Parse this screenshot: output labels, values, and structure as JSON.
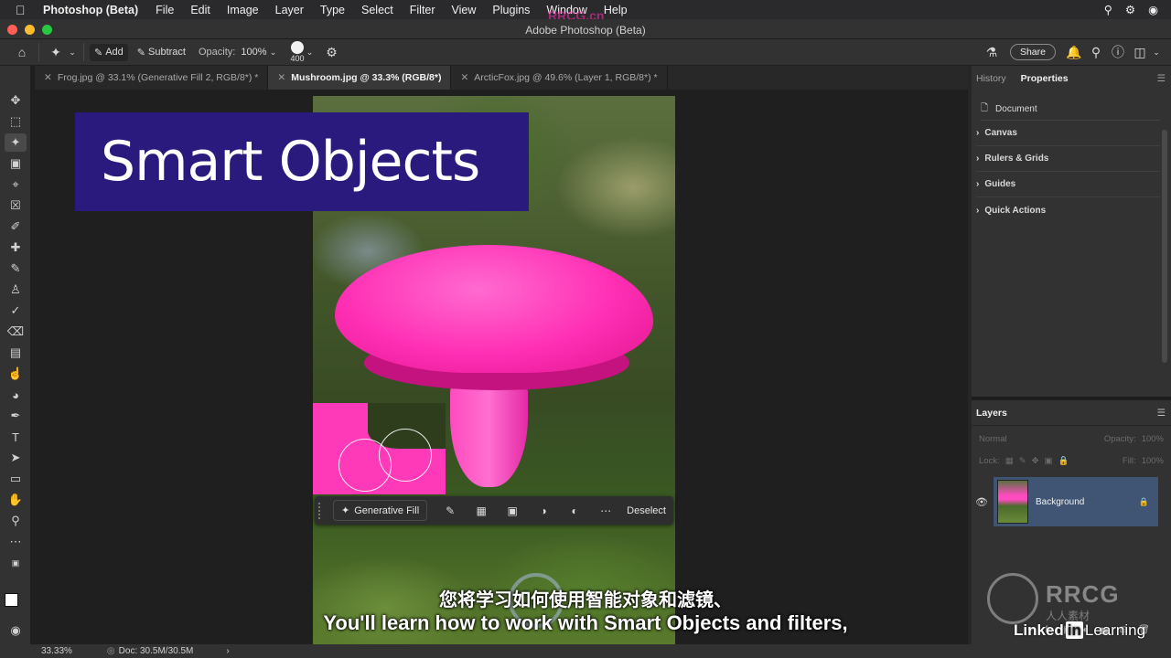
{
  "menubar": {
    "app_name": "Photoshop (Beta)",
    "items": [
      "File",
      "Edit",
      "Image",
      "Layer",
      "Type",
      "Select",
      "Filter",
      "View",
      "Plugins",
      "Window",
      "Help"
    ],
    "watermark": "RRCG.cn"
  },
  "window": {
    "title": "Adobe Photoshop (Beta)"
  },
  "options": {
    "add_label": "Add",
    "subtract_label": "Subtract",
    "opacity_label": "Opacity:",
    "opacity_value": "100%",
    "brush_size": "400",
    "share_label": "Share"
  },
  "tabs": [
    {
      "label": "Frog.jpg @ 33.1% (Generative Fill 2, RGB/8*) *",
      "active": false
    },
    {
      "label": "Mushroom.jpg @ 33.3% (RGB/8*)",
      "active": true
    },
    {
      "label": "ArcticFox.jpg @ 49.6% (Layer 1, RGB/8*) *",
      "active": false
    }
  ],
  "canvas": {
    "banner_text": "Smart Objects"
  },
  "context_bar": {
    "generative_fill": "Generative Fill",
    "deselect": "Deselect"
  },
  "subtitles": {
    "chinese": "您将学习如何使用智能对象和滤镜、",
    "english": "You'll learn how to work with Smart Objects and filters,"
  },
  "properties_panel": {
    "tab_history": "History",
    "tab_properties": "Properties",
    "document_label": "Document",
    "sections": [
      "Canvas",
      "Rulers & Grids",
      "Guides",
      "Quick Actions"
    ]
  },
  "layers_panel": {
    "title": "Layers",
    "blend_mode": "Normal",
    "opacity_label": "Opacity:",
    "opacity_value": "100%",
    "lock_label": "Lock:",
    "fill_label": "Fill:",
    "fill_value": "100%",
    "layer_name": "Background"
  },
  "status": {
    "zoom": "33.33%",
    "doc": "Doc: 30.5M/30.5M"
  },
  "watermarks": {
    "linkedin_a": "Linked",
    "linkedin_in": "in",
    "linkedin_b": "Learning",
    "rrcg": "RRCG",
    "rrcg_sub": "人人素材"
  },
  "colors": {
    "banner_bg": "#2b1a7e",
    "mushroom": "#ff2fb4",
    "selected_layer": "#3f5573"
  }
}
